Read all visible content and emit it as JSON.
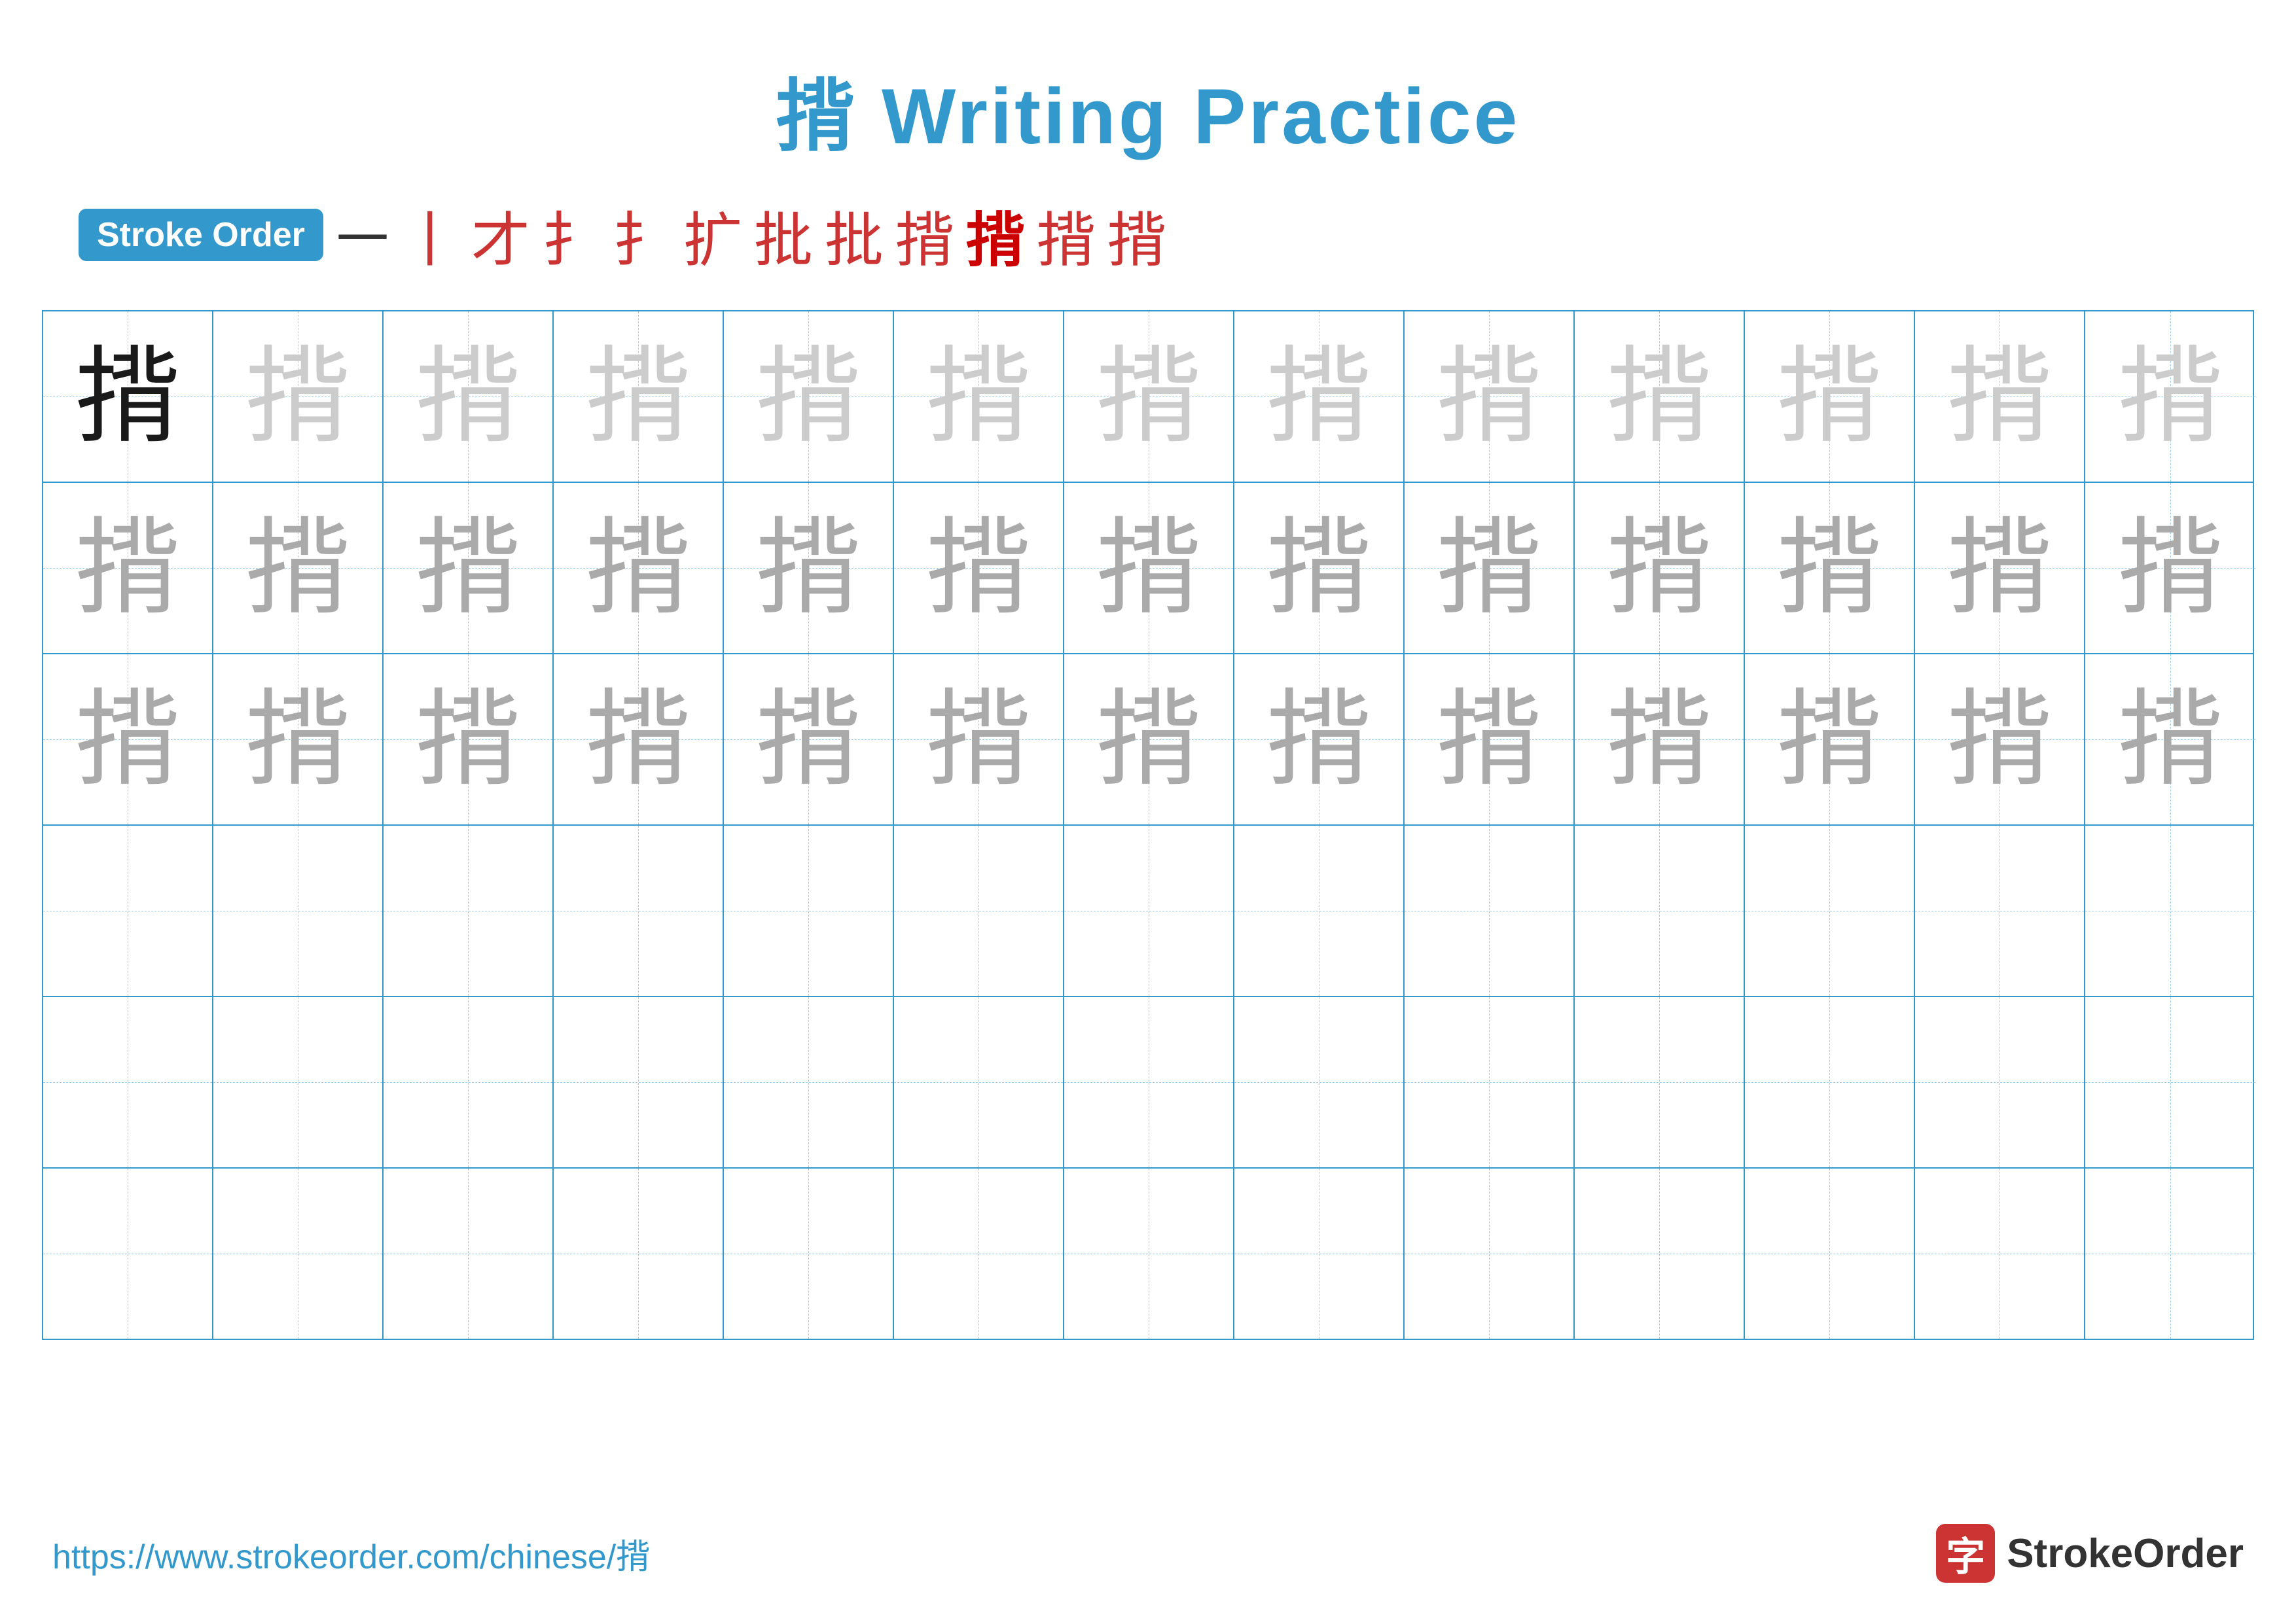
{
  "header": {
    "title": "揹 Writing Practice"
  },
  "stroke_order": {
    "badge_label": "Stroke Order",
    "strokes": [
      "一",
      "丨",
      "才",
      "扌",
      "扌",
      "扩",
      "批",
      "批",
      "揹",
      "揹",
      "揹",
      "揹"
    ]
  },
  "grid": {
    "rows": 6,
    "cols": 13,
    "char": "揹",
    "row1_type": "dark_then_light",
    "row2_type": "light",
    "row3_type": "light",
    "row4_type": "empty",
    "row5_type": "empty",
    "row6_type": "empty"
  },
  "footer": {
    "url": "https://www.strokeorder.com/chinese/揹",
    "logo_text": "StrokeOrder",
    "logo_icon": "字"
  }
}
